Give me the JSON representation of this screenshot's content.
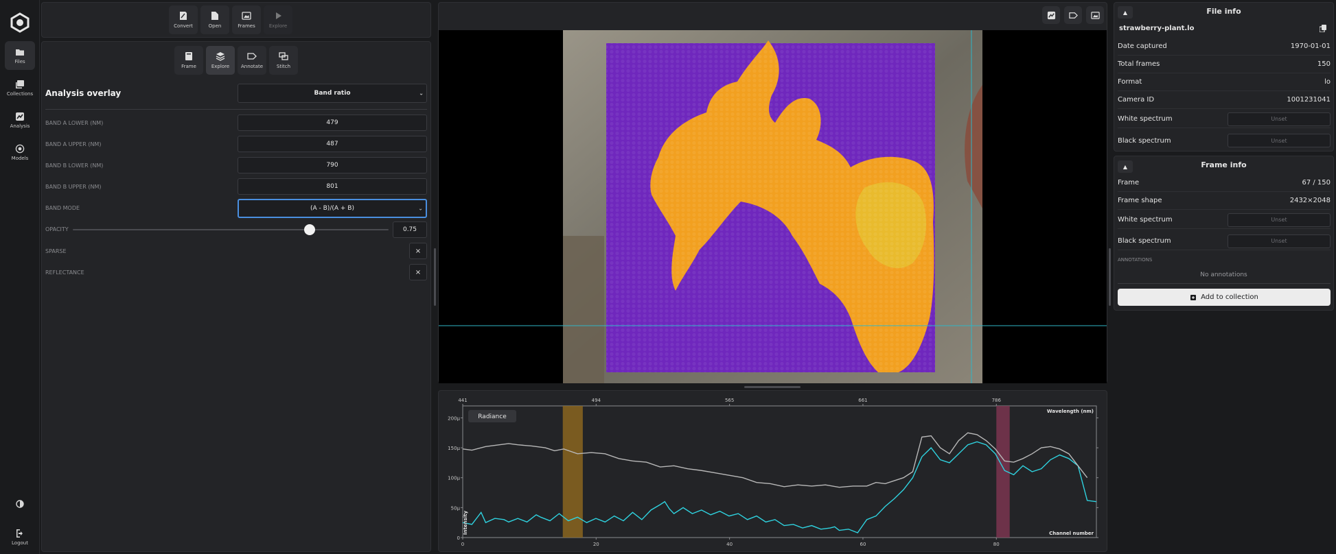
{
  "rail": {
    "items": [
      {
        "label": "Files",
        "icon": "folder-icon"
      },
      {
        "label": "Collections",
        "icon": "collections-icon"
      },
      {
        "label": "Analysis",
        "icon": "chart-icon"
      },
      {
        "label": "Models",
        "icon": "models-icon"
      }
    ],
    "logout": "Logout"
  },
  "top_toolbar": {
    "convert": "Convert",
    "open": "Open",
    "frames": "Frames",
    "explore": "Explore"
  },
  "mode_toolbar": {
    "frame": "Frame",
    "explore": "Explore",
    "annotate": "Annotate",
    "stitch": "Stitch"
  },
  "overlay": {
    "title": "Analysis overlay",
    "overlay_type": "Band ratio",
    "band_a_lower_label": "BAND A LOWER (NM)",
    "band_a_lower": "479",
    "band_a_upper_label": "BAND A UPPER (NM)",
    "band_a_upper": "487",
    "band_b_lower_label": "BAND B LOWER (NM)",
    "band_b_lower": "790",
    "band_b_upper_label": "BAND B UPPER (NM)",
    "band_b_upper": "801",
    "band_mode_label": "BAND MODE",
    "band_mode": "(A - B)/(A + B)",
    "opacity_label": "OPACITY",
    "opacity": "0.75",
    "opacity_fraction": 0.75,
    "sparse_label": "SPARSE",
    "reflectance_label": "REFLECTANCE",
    "x_symbol": "×"
  },
  "file_info": {
    "title": "File info",
    "filename": "strawberry-plant.lo",
    "rows": [
      {
        "label": "Date captured",
        "value": "1970-01-01"
      },
      {
        "label": "Total frames",
        "value": "150"
      },
      {
        "label": "Format",
        "value": "lo"
      },
      {
        "label": "Camera ID",
        "value": "1001231041"
      }
    ],
    "white_spectrum": "White spectrum",
    "black_spectrum": "Black spectrum",
    "unset": "Unset"
  },
  "frame_info": {
    "title": "Frame info",
    "frame_label": "Frame",
    "frame_value": "67 / 150",
    "shape_label": "Frame shape",
    "shape_value": "2432×2048",
    "white_spectrum": "White spectrum",
    "black_spectrum": "Black spectrum",
    "unset": "Unset",
    "annotations_label": "ANNOTATIONS",
    "no_annotations": "No annotations",
    "add_to_collection": "Add to collection"
  },
  "colors": {
    "accent": "#4a8fe0",
    "radiance_line": "#2fd3e0",
    "reference_line": "#b8b8b8",
    "band_a": "#8a6520",
    "band_b": "#7a3550"
  },
  "chart_data": {
    "type": "line",
    "legend": "Radiance",
    "xlabel": "Channel number",
    "x2label": "Wavelength (nm)",
    "ylabel": "Intensity",
    "x_ticks": [
      0,
      20,
      40,
      60,
      80
    ],
    "x2_ticks": [
      {
        "channel": 0,
        "label": "441"
      },
      {
        "channel": 20,
        "label": "494"
      },
      {
        "channel": 40,
        "label": "565"
      },
      {
        "channel": 60,
        "label": "661"
      },
      {
        "channel": 80,
        "label": "786"
      }
    ],
    "y_ticks": [
      {
        "value": 0,
        "label": "0"
      },
      {
        "value": 50,
        "label": "50µ"
      },
      {
        "value": 100,
        "label": "100µ"
      },
      {
        "value": 150,
        "label": "150µ"
      },
      {
        "value": 200,
        "label": "200µ"
      }
    ],
    "xlim": [
      0,
      95
    ],
    "ylim": [
      0,
      220
    ],
    "band_a": [
      15,
      18
    ],
    "band_b": [
      80,
      82
    ],
    "series": [
      {
        "key": "radiance",
        "values": [
          [
            0,
            25
          ],
          [
            2,
            22
          ],
          [
            4,
            42
          ],
          [
            5,
            25
          ],
          [
            7,
            32
          ],
          [
            9,
            30
          ],
          [
            10,
            26
          ],
          [
            12,
            32
          ],
          [
            14,
            26
          ],
          [
            16,
            38
          ],
          [
            17,
            34
          ],
          [
            19,
            28
          ],
          [
            21,
            40
          ],
          [
            23,
            28
          ],
          [
            25,
            34
          ],
          [
            27,
            25
          ],
          [
            29,
            32
          ],
          [
            31,
            26
          ],
          [
            33,
            36
          ],
          [
            35,
            28
          ],
          [
            37,
            42
          ],
          [
            39,
            30
          ],
          [
            41,
            46
          ],
          [
            43,
            55
          ],
          [
            44,
            60
          ],
          [
            45,
            48
          ],
          [
            46,
            40
          ],
          [
            48,
            50
          ],
          [
            50,
            40
          ],
          [
            52,
            46
          ],
          [
            54,
            38
          ],
          [
            56,
            44
          ],
          [
            58,
            36
          ],
          [
            60,
            40
          ],
          [
            62,
            30
          ],
          [
            64,
            36
          ],
          [
            66,
            26
          ],
          [
            68,
            30
          ],
          [
            70,
            20
          ],
          [
            72,
            22
          ],
          [
            74,
            16
          ],
          [
            76,
            20
          ],
          [
            78,
            14
          ],
          [
            80,
            16
          ],
          [
            81,
            18
          ],
          [
            82,
            12
          ],
          [
            84,
            14
          ],
          [
            86,
            8
          ],
          [
            88,
            30
          ],
          [
            90,
            36
          ],
          [
            92,
            52
          ],
          [
            94,
            65
          ],
          [
            96,
            80
          ],
          [
            98,
            100
          ],
          [
            100,
            135
          ],
          [
            102,
            150
          ],
          [
            104,
            130
          ],
          [
            106,
            125
          ],
          [
            108,
            140
          ],
          [
            110,
            155
          ],
          [
            112,
            160
          ],
          [
            114,
            155
          ],
          [
            116,
            140
          ],
          [
            118,
            112
          ],
          [
            120,
            105
          ],
          [
            122,
            120
          ],
          [
            124,
            110
          ],
          [
            126,
            115
          ],
          [
            128,
            130
          ],
          [
            130,
            138
          ],
          [
            132,
            132
          ],
          [
            134,
            120
          ],
          [
            136,
            62
          ],
          [
            138,
            60
          ]
        ]
      },
      {
        "key": "reference",
        "values": [
          [
            0,
            148
          ],
          [
            2,
            146
          ],
          [
            5,
            152
          ],
          [
            8,
            155
          ],
          [
            10,
            157
          ],
          [
            12,
            155
          ],
          [
            15,
            153
          ],
          [
            18,
            150
          ],
          [
            20,
            145
          ],
          [
            22,
            148
          ],
          [
            25,
            140
          ],
          [
            28,
            142
          ],
          [
            31,
            140
          ],
          [
            34,
            132
          ],
          [
            37,
            128
          ],
          [
            40,
            126
          ],
          [
            43,
            118
          ],
          [
            46,
            120
          ],
          [
            49,
            115
          ],
          [
            52,
            112
          ],
          [
            55,
            108
          ],
          [
            58,
            104
          ],
          [
            61,
            100
          ],
          [
            64,
            92
          ],
          [
            67,
            90
          ],
          [
            70,
            85
          ],
          [
            73,
            88
          ],
          [
            76,
            86
          ],
          [
            79,
            88
          ],
          [
            82,
            84
          ],
          [
            85,
            86
          ],
          [
            88,
            86
          ],
          [
            90,
            92
          ],
          [
            92,
            90
          ],
          [
            94,
            95
          ],
          [
            96,
            100
          ],
          [
            98,
            110
          ],
          [
            100,
            168
          ],
          [
            102,
            170
          ],
          [
            104,
            150
          ],
          [
            106,
            140
          ],
          [
            108,
            162
          ],
          [
            110,
            175
          ],
          [
            112,
            172
          ],
          [
            114,
            162
          ],
          [
            116,
            148
          ],
          [
            118,
            128
          ],
          [
            120,
            126
          ],
          [
            122,
            132
          ],
          [
            124,
            140
          ],
          [
            126,
            150
          ],
          [
            128,
            152
          ],
          [
            130,
            148
          ],
          [
            132,
            140
          ],
          [
            134,
            120
          ],
          [
            136,
            100
          ]
        ]
      }
    ]
  }
}
